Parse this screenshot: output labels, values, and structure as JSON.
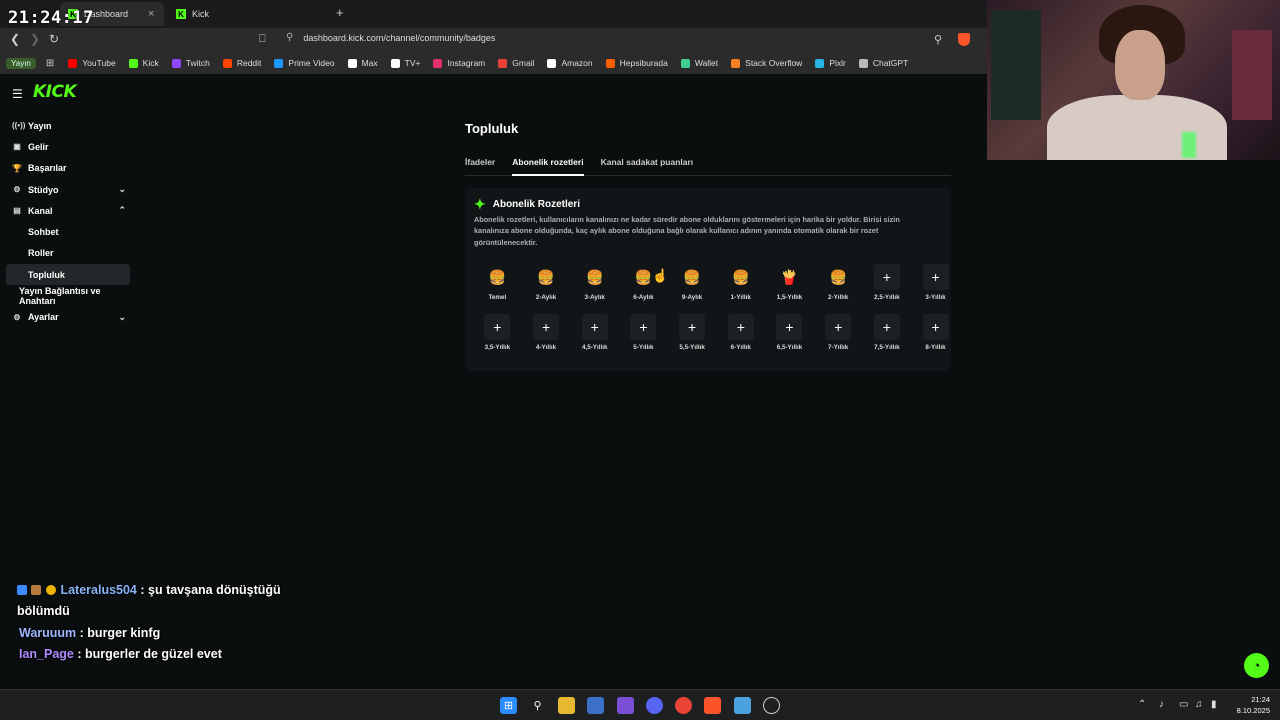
{
  "overlay": {
    "clock": "21:24:17"
  },
  "browser": {
    "tabs": [
      {
        "label": "Dashboard",
        "close": "×"
      },
      {
        "label": "Kick"
      }
    ],
    "new_tab": "+",
    "url": "dashboard.kick.com/channel/community/badges",
    "bookmarks": [
      {
        "label": "YouTube",
        "color": "#ff0000"
      },
      {
        "label": "Kick",
        "color": "#53fc18"
      },
      {
        "label": "Twitch",
        "color": "#9146ff"
      },
      {
        "label": "Reddit",
        "color": "#ff4500"
      },
      {
        "label": "Prime Video",
        "color": "#1a98ff"
      },
      {
        "label": "Max",
        "color": "#ffffff"
      },
      {
        "label": "TV+",
        "color": "#ffffff"
      },
      {
        "label": "Instagram",
        "color": "#e1306c"
      },
      {
        "label": "Gmail",
        "color": "#ea4335"
      },
      {
        "label": "Amazon",
        "color": "#ffffff"
      },
      {
        "label": "Hepsiburada",
        "color": "#ff6000"
      },
      {
        "label": "Wallet",
        "color": "#3ecf8e"
      },
      {
        "label": "Stack Overflow",
        "color": "#f48024"
      },
      {
        "label": "Pixlr",
        "color": "#27b6e6"
      },
      {
        "label": "ChatGPT",
        "color": "#bbbbbb"
      }
    ],
    "yayin_chip": "Yayın"
  },
  "kick": {
    "logo": "KICK",
    "sidebar": [
      {
        "label": "Yayın",
        "icon": "((•))",
        "level": 0
      },
      {
        "label": "Gelir",
        "icon": "▣",
        "level": 0
      },
      {
        "label": "Başarılar",
        "icon": "🏆",
        "level": 0
      },
      {
        "label": "Stüdyo",
        "icon": "⚙",
        "level": 0,
        "chevron": "⌄"
      },
      {
        "label": "Kanal",
        "icon": "▤",
        "level": 0,
        "chevron": "⌃"
      },
      {
        "label": "Sohbet",
        "level": 1
      },
      {
        "label": "Roller",
        "level": 1
      },
      {
        "label": "Topluluk",
        "level": 1,
        "active": true
      },
      {
        "label": "Yayın Bağlantısı ve Anahtarı",
        "level": 2
      },
      {
        "label": "Ayarlar",
        "icon": "⚙",
        "level": 0,
        "chevron": "⌄"
      }
    ],
    "page_title": "Topluluk",
    "tabs": [
      {
        "label": "İfadeler"
      },
      {
        "label": "Abonelik rozetleri",
        "active": true
      },
      {
        "label": "Kanal sadakat puanları"
      }
    ],
    "card": {
      "title": "Abonelik Rozetleri",
      "description": "Abonelik rozetleri, kullanıcıların kanalınızı ne kadar süredir abone olduklarını göstermeleri için harika bir yoldur. Birisi sizin kanalınıza abone olduğunda, kaç aylık abone olduğuna bağlı olarak kullanıcı adının yanında otomatik olarak bir rozet görüntülenecektir."
    },
    "badges": [
      {
        "label": "Temel",
        "icon": "🍔"
      },
      {
        "label": "2-Aylık",
        "icon": "🍔"
      },
      {
        "label": "3-Aylık",
        "icon": "🍔"
      },
      {
        "label": "6-Aylık",
        "icon": "🍔"
      },
      {
        "label": "9-Aylık",
        "icon": "🍔"
      },
      {
        "label": "1-Yıllık",
        "icon": "🍔"
      },
      {
        "label": "1,5-Yıllık",
        "icon": "🍟"
      },
      {
        "label": "2-Yıllık",
        "icon": "🍔"
      },
      {
        "label": "2,5-Yıllık",
        "icon": "+"
      },
      {
        "label": "3-Yıllık",
        "icon": "+"
      },
      {
        "label": "3,5-Yıllık",
        "icon": "+"
      },
      {
        "label": "4-Yıllık",
        "icon": "+"
      },
      {
        "label": "4,5-Yıllık",
        "icon": "+"
      },
      {
        "label": "5-Yıllık",
        "icon": "+"
      },
      {
        "label": "5,5-Yıllık",
        "icon": "+"
      },
      {
        "label": "6-Yıllık",
        "icon": "+"
      },
      {
        "label": "6,5-Yıllık",
        "icon": "+"
      },
      {
        "label": "7-Yıllık",
        "icon": "+"
      },
      {
        "label": "7,5-Yıllık",
        "icon": "+"
      },
      {
        "label": "8-Yıllık",
        "icon": "+"
      }
    ]
  },
  "chat": [
    {
      "user": "Lateralus504",
      "text": ": şu tavşana dönüştüğü",
      "cont": "bölümdü"
    },
    {
      "user": "Waruuum",
      "text": ": burger kinfg"
    },
    {
      "user": "Ian_Page",
      "text": ": burgerler de güzel evet"
    }
  ],
  "taskbar": {
    "time": "21:24",
    "date": "8.10.2025"
  },
  "colors": {
    "accent": "#53fc18",
    "background": "#0b0e0f"
  }
}
